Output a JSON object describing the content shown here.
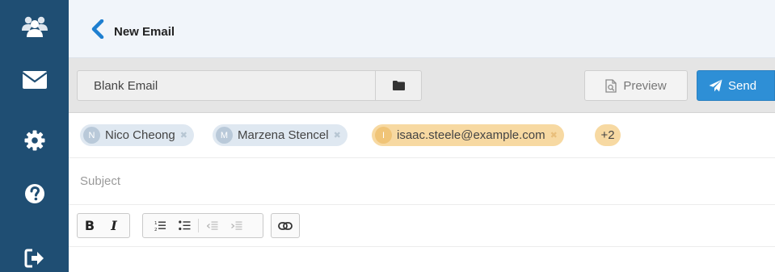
{
  "sidebar": {
    "items": [
      {
        "icon": "users-icon"
      },
      {
        "icon": "envelope-icon"
      },
      {
        "icon": "gear-icon"
      },
      {
        "icon": "question-circle-icon"
      },
      {
        "icon": "sign-out-icon"
      }
    ]
  },
  "header": {
    "title": "New Email",
    "back_icon": "chevron-left-icon"
  },
  "toolbar": {
    "template_value": "Blank Email",
    "folder_icon": "folder-icon",
    "preview_label": "Preview",
    "send_label": "Send"
  },
  "recipients": {
    "chips": [
      {
        "name": "Nico Cheong",
        "type": "contact",
        "initial": "N"
      },
      {
        "name": "Marzena Stencel",
        "type": "contact",
        "initial": "M"
      },
      {
        "name": "isaac.steele@example.com",
        "type": "email",
        "initial": "I"
      }
    ],
    "more_count": "+2"
  },
  "subject": {
    "placeholder": "Subject",
    "value": ""
  },
  "formatting": {
    "bold_label": "B",
    "italic_label": "I"
  },
  "colors": {
    "sidebar_bg": "#1f4e73",
    "accent_blue": "#2e8fd6",
    "chip_contact": "#dfe8f1",
    "chip_email": "#f7d9a2"
  }
}
